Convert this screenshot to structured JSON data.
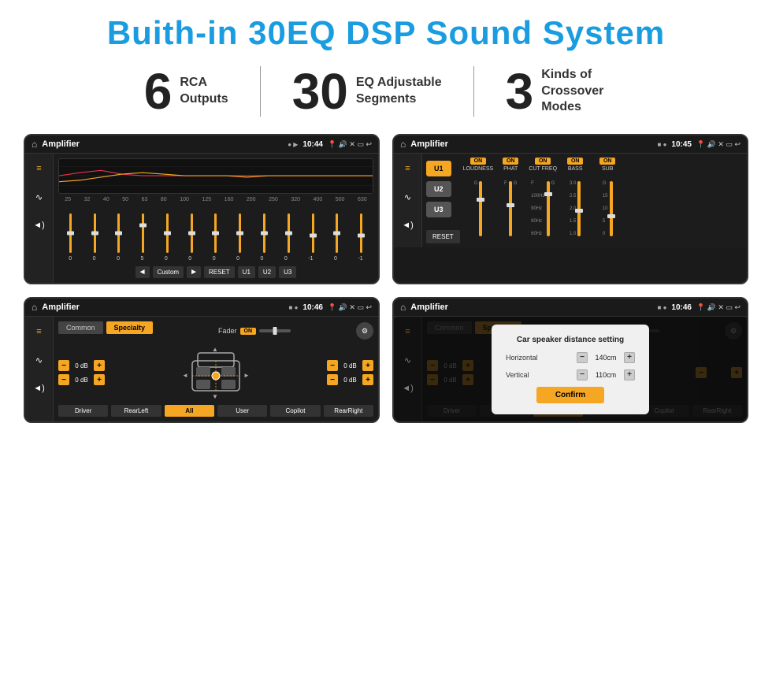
{
  "header": {
    "title": "Buith-in 30EQ DSP Sound System"
  },
  "stats": [
    {
      "number": "6",
      "desc_line1": "RCA",
      "desc_line2": "Outputs"
    },
    {
      "number": "30",
      "desc_line1": "EQ Adjustable",
      "desc_line2": "Segments"
    },
    {
      "number": "3",
      "desc_line1": "Kinds of",
      "desc_line2": "Crossover Modes"
    }
  ],
  "screen1": {
    "app_name": "Amplifier",
    "time": "10:44",
    "eq_freqs": [
      "25",
      "32",
      "40",
      "50",
      "63",
      "80",
      "100",
      "125",
      "160",
      "200",
      "250",
      "320",
      "400",
      "500",
      "630"
    ],
    "eq_values": [
      "0",
      "0",
      "0",
      "5",
      "0",
      "0",
      "0",
      "0",
      "0",
      "0",
      "-1",
      "0",
      "-1"
    ],
    "bottom_btns": [
      "Custom",
      "RESET",
      "U1",
      "U2",
      "U3"
    ]
  },
  "screen2": {
    "app_name": "Amplifier",
    "time": "10:45",
    "channels": [
      {
        "id": "U1",
        "on": true,
        "label": "LOUDNESS"
      },
      {
        "id": "U2",
        "on": true,
        "label": "PHAT"
      },
      {
        "id": "U3",
        "on": true,
        "label": "CUT FREQ"
      },
      {
        "id": "U4",
        "on": true,
        "label": "BASS"
      },
      {
        "id": "U5",
        "on": true,
        "label": "SUB"
      }
    ],
    "reset_label": "RESET"
  },
  "screen3": {
    "app_name": "Amplifier",
    "time": "10:46",
    "tabs": [
      "Common",
      "Specialty"
    ],
    "fader_label": "Fader",
    "fader_on": "ON",
    "volume_values": [
      "0 dB",
      "0 dB",
      "0 dB",
      "0 dB"
    ],
    "bottom_btns": [
      "Driver",
      "RearLeft",
      "All",
      "User",
      "Copilot",
      "RearRight"
    ]
  },
  "screen4": {
    "app_name": "Amplifier",
    "time": "10:46",
    "tabs": [
      "Common",
      "Specialty"
    ],
    "dialog": {
      "title": "Car speaker distance setting",
      "horizontal_label": "Horizontal",
      "horizontal_value": "140cm",
      "vertical_label": "Vertical",
      "vertical_value": "110cm",
      "confirm_label": "Confirm"
    },
    "volume_values": [
      "0 dB",
      "0 dB"
    ],
    "bottom_btns": [
      "Driver",
      "RearLeft",
      "All",
      "User",
      "Copilot",
      "RearRight"
    ]
  }
}
